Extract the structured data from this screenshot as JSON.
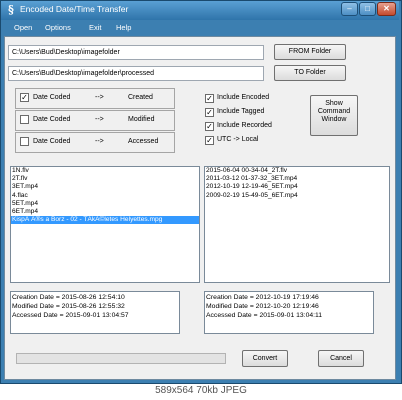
{
  "window": {
    "title": "Encoded Date/Time Transfer",
    "app_icon": "§"
  },
  "menu": [
    "Open",
    "Options",
    "Exit",
    "Help"
  ],
  "paths": {
    "from": "C:\\Users\\Bud\\Desktop\\imagefolder",
    "to": "C:\\Users\\Bud\\Desktop\\imagefolder\\processed"
  },
  "buttons": {
    "from_folder": "FROM Folder",
    "to_folder": "TO Folder",
    "show_command": "Show Command Window",
    "convert": "Convert",
    "cancel": "Cancel"
  },
  "date_mappings": [
    {
      "source": "Date Coded",
      "arrow": "-->",
      "target": "Created",
      "checked": true
    },
    {
      "source": "Date Coded",
      "arrow": "-->",
      "target": "Modified",
      "checked": false
    },
    {
      "source": "Date Coded",
      "arrow": "-->",
      "target": "Accessed",
      "checked": false
    }
  ],
  "options": [
    {
      "label": "Include Encoded",
      "checked": true
    },
    {
      "label": "Include Tagged",
      "checked": true
    },
    {
      "label": "Include Recorded",
      "checked": true
    },
    {
      "label": "UTC -> Local",
      "checked": true
    }
  ],
  "source_files": [
    "1N.flv",
    "2T.flv",
    "3ET.mp4",
    "4.flac",
    "5ET.mp4",
    "6ET.mp4",
    "KispĂ Ă®s a Borz - 02 - TĂ­kĂ©letes Helyettes.mpg"
  ],
  "source_selected_index": 6,
  "target_files": [
    "2015-06-04 00-34-04_2T.flv",
    "2011-03-12 01-37-32_3ET.mp4",
    "2012-10-19 12-19-46_5ET.mp4",
    "2009-02-19 15-49-05_6ET.mp4"
  ],
  "source_info": [
    "Creation Date = 2015-08-26 12:54:10",
    "Modified Date = 2015-08-26 12:55:32",
    "Accessed Date = 2015-09-01 13:04:57"
  ],
  "target_info": [
    "Creation Date = 2012-10-19 17:19:46",
    "Modified Date = 2012-10-20 12:19:46",
    "Accessed Date = 2015-09-01 13:04:11"
  ],
  "progress": 0,
  "footer": "589x564 70kb JPEG",
  "colors": {
    "title_bar": "#3c7fb1",
    "selection": "#3399ff",
    "check": "#000000"
  }
}
